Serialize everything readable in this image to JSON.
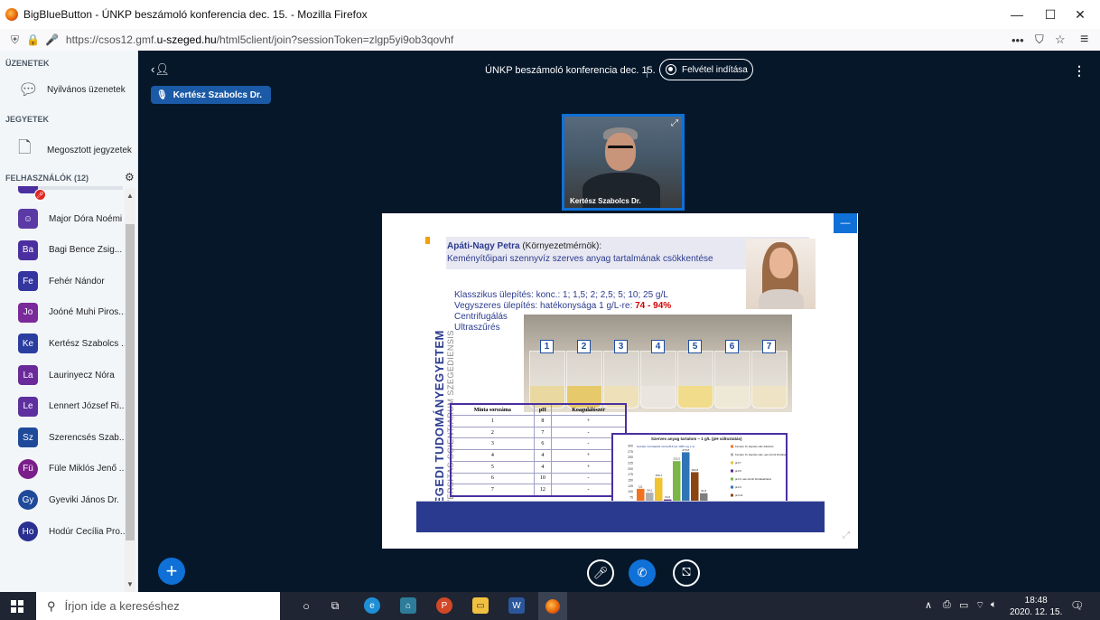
{
  "browser": {
    "window_title": "BigBlueButton - ÚNKP beszámoló konferencia dec. 15. - Mozilla Firefox",
    "url_prefix": "https://csos12.gmf.",
    "url_domain": "u-szeged.hu",
    "url_suffix": "/html5client/join?sessionToken=zlgp5yi9ob3qovhf",
    "minimize": "—",
    "maximize": "☐",
    "close": "✕",
    "overflow": "•••",
    "pocket": "⛉",
    "star": "☆",
    "menu": "≡"
  },
  "sidebar": {
    "messages_title": "ÜZENETEK",
    "public_chat": "Nyilvános üzenetek",
    "notes_title": "JEGYETEK",
    "shared_notes": "Megosztott jegyzetek",
    "users_title": "FELHASZNÁLÓK (12)",
    "users": [
      {
        "initials": "☺",
        "name": "Major Dóra Noémi",
        "color": "#5b3aa6",
        "status": "muted"
      },
      {
        "initials": "Ba",
        "name": "Bagi Bence Zsig...",
        "color": "#4b2fa0",
        "status": "muted"
      },
      {
        "initials": "Fe",
        "name": "Fehér Nándor",
        "color": "#35359f",
        "status": "muted"
      },
      {
        "initials": "Jo",
        "name": "Joóné Muhi Piros...",
        "color": "#7a2a9a",
        "status": "listen"
      },
      {
        "initials": "Ke",
        "name": "Kertész Szabolcs ...",
        "color": "#2a3ea0",
        "status": "listen"
      },
      {
        "initials": "La",
        "name": "Laurinyecz Nóra",
        "color": "#6a2a9a",
        "status": "muted"
      },
      {
        "initials": "Le",
        "name": "Lennert József Ri...",
        "color": "#5d2f9f",
        "status": "muted"
      },
      {
        "initials": "Sz",
        "name": "Szerencsés Szab...",
        "color": "#1f4a9a",
        "status": "muted"
      },
      {
        "initials": "Fü",
        "name": "Füle Miklós Jenő ...",
        "color": "#7a1f8a",
        "status": "listen"
      },
      {
        "initials": "Gy",
        "name": "Gyeviki János Dr.",
        "color": "#1f4a9a",
        "status": "listen"
      },
      {
        "initials": "Ho",
        "name": "Hodúr Cecília Pro...",
        "color": "#2a3090",
        "status": "muted"
      }
    ]
  },
  "main": {
    "meeting_title": "ÚNKP beszámoló konferencia dec. 15.",
    "record_label": "Felvétel indítása",
    "talking": "Kertész Szabolcs Dr.",
    "webcam_name": "Kertész Szabolcs Dr."
  },
  "slide": {
    "vertical_main": "SZEGEDI TUDOMÁNYEGYETEM",
    "vertical_sub": "UNIVERSITAS SCIENTIARUM SZEGEDIENSIS",
    "author": "Apáti-Nagy Petra",
    "author_role": " (Környezetmérnök):",
    "topic": "Keményítőipari szennyvíz szerves anyag tartalmának csökkentése",
    "line1": "Klasszikus ülepítés: konc.: 1; 1,5; 2; 2,5; 5; 10; 25 g/L",
    "line2_prefix": "Vegyszeres ülepítés: hatékonysága 1 g/L-re: ",
    "line2_highlight": "74 - 94%",
    "line3": "Centrifugálás",
    "line4": "Ultraszűrés",
    "beaker_numbers": [
      "1",
      "2",
      "3",
      "4",
      "5",
      "6",
      "7"
    ],
    "table": {
      "headers": [
        "Minta sorszáma",
        "pH",
        "Koaguláló­szer"
      ],
      "rows": [
        [
          "1",
          "8",
          "+"
        ],
        [
          "2",
          "7",
          "-"
        ],
        [
          "3",
          "6",
          "-"
        ],
        [
          "4",
          "4",
          "+"
        ],
        [
          "5",
          "4",
          "+"
        ],
        [
          "6",
          "10",
          "-"
        ],
        [
          "7",
          "12",
          "-"
        ]
      ]
    }
  },
  "chart_data": {
    "type": "bar",
    "title": "Szerves anyag tartalom – 1 g/L (pH változtatás)",
    "ylabel": "",
    "ylim": [
      0,
      300
    ],
    "yticks": [
      0,
      25,
      50,
      75,
      100,
      125,
      150,
      175,
      200,
      225,
      250,
      275,
      300
    ],
    "categories": [
      "1",
      "2",
      "3",
      "4",
      "5",
      "6",
      "7"
    ],
    "values": [
      111,
      94.1,
      159.1,
      64.6,
      232.2,
      270.8,
      183.8,
      91.8
    ],
    "bar_colors": [
      "#f2731f",
      "#b0b0b0",
      "#f1c232",
      "#5b2a8a",
      "#7ab648",
      "#2f75b5",
      "#8b4513",
      "#7f7f7f"
    ],
    "value_labels": [
      "111",
      "94,1",
      "159,1",
      "64,6",
      "232,2",
      "270,8",
      "183,8",
      "91,8"
    ],
    "callout": "Kezdeti, hozzáadott minta 816 (az 1065 mg L-1)",
    "legend": [
      "Kezdeti, 1h ülepítés után felülúszó",
      "Kezdeti, 1h ülepítés után, aaz elmúlt fűszabadítékot",
      "pH=7",
      "pH=6",
      "pH=4, aaz elmúlt fűszabadítékot",
      "pH=4",
      "pH=10",
      "pH=12"
    ]
  },
  "taskbar": {
    "search_placeholder": "Írjon ide a kereséshez",
    "time": "18:48",
    "date": "2020. 12. 15.",
    "tray_up": "∧",
    "notif_count": "1"
  }
}
